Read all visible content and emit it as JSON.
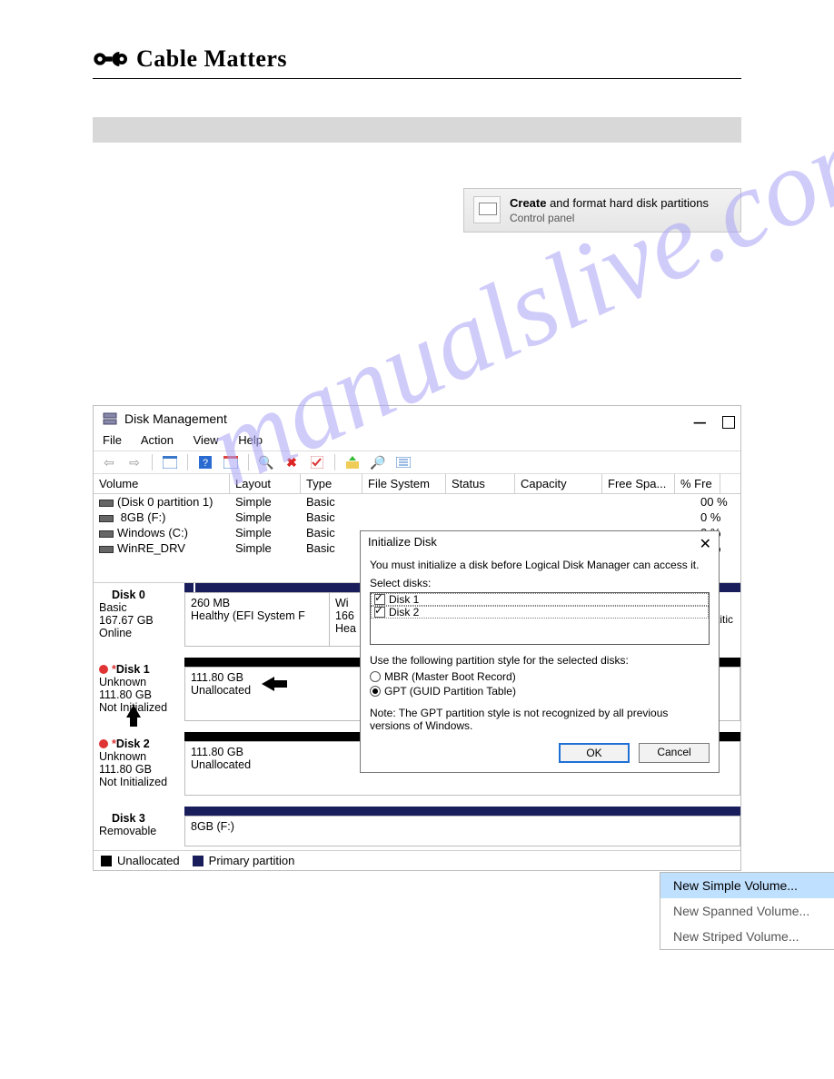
{
  "brand": {
    "name": "Cable Matters"
  },
  "watermark": "manualslive.com",
  "control_panel": {
    "title_bold": "Create",
    "title_rest": " and format hard disk partitions",
    "subtitle": "Control panel"
  },
  "window": {
    "title": "Disk Management",
    "menu": [
      "File",
      "Action",
      "View",
      "Help"
    ],
    "columns": [
      "Volume",
      "Layout",
      "Type",
      "File System",
      "Status",
      "Capacity",
      "Free Spa...",
      "% Fre"
    ],
    "rows": [
      {
        "vol": "(Disk 0 partition 1)",
        "layout": "Simple",
        "type": "Basic",
        "cap": "",
        "pctfree": "00 %"
      },
      {
        "vol": "        8GB (F:)",
        "layout": "Simple",
        "type": "Basic",
        "cap": "",
        "pctfree": "0 %"
      },
      {
        "vol": "Windows (C:)",
        "layout": "Simple",
        "type": "Basic",
        "cap": "",
        "pctfree": "0 %"
      },
      {
        "vol": "WinRE_DRV",
        "layout": "Simple",
        "type": "Basic",
        "cap": "",
        "pctfree": "2 %"
      }
    ],
    "disks": {
      "d0": {
        "title": "Disk 0",
        "l1": "Basic",
        "l2": "167.67 GB",
        "l3": "Online",
        "seg1_l1": "260 MB",
        "seg1_l2": "Healthy (EFI System F",
        "seg2_l1": "Wi",
        "seg2_l2": "166",
        "seg2_l3": "Hea"
      },
      "d1": {
        "title": "Disk 1",
        "l1": "Unknown",
        "l2": "111.80 GB",
        "l3": "Not Initialized",
        "seg_l1": "111.80 GB",
        "seg_l2": "Unallocated"
      },
      "d2": {
        "title": "Disk 2",
        "l1": "Unknown",
        "l2": "111.80 GB",
        "l3": "Not Initialized",
        "seg_l1": "111.80 GB",
        "seg_l2": "Unallocated"
      },
      "d3": {
        "title": "Disk 3",
        "l1": "Removable",
        "seg_l1": "          8GB  (F:)"
      }
    },
    "legend": {
      "unalloc": "Unallocated",
      "primary": "Primary partition"
    }
  },
  "dialog": {
    "title": "Initialize Disk",
    "intro": "You must initialize a disk before Logical Disk Manager can access it.",
    "select_label": "Select disks:",
    "disks": [
      "Disk 1",
      "Disk 2"
    ],
    "style_label": "Use the following partition style for the selected disks:",
    "mbr": "MBR (Master Boot Record)",
    "gpt": "GPT (GUID Partition Table)",
    "note": "Note: The GPT partition style is not recognized by all previous versions of Windows.",
    "ok": "OK",
    "cancel": "Cancel"
  },
  "context_menu": {
    "items": [
      "New Simple Volume...",
      "New Spanned Volume...",
      "New Striped Volume..."
    ]
  }
}
